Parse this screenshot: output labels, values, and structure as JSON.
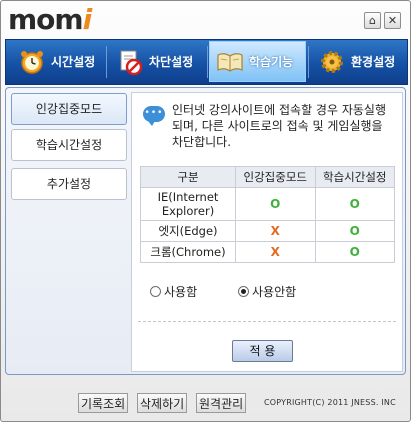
{
  "app": {
    "logo_text": "mom",
    "logo_accent": "i",
    "home_button": "⌂",
    "close_button": "✕"
  },
  "tabs": [
    {
      "label": "시간설정",
      "icon": "alarm-clock-icon"
    },
    {
      "label": "차단설정",
      "icon": "blocked-document-icon"
    },
    {
      "label": "학습기능",
      "icon": "open-book-icon",
      "active": true
    },
    {
      "label": "환경설정",
      "icon": "gear-icon"
    }
  ],
  "sidebar": {
    "items": [
      {
        "label": "인강집중모드",
        "active": true
      },
      {
        "label": "학습시간설정"
      },
      {
        "label": "추가설정"
      }
    ]
  },
  "info": {
    "text": "인터넷 강의사이트에 접속할 경우 자동실행되며, 다른 사이트로의 접속 및 게임실행을 차단합니다."
  },
  "table": {
    "headers": [
      "구분",
      "인강집중모드",
      "학습시간설정"
    ],
    "rows": [
      {
        "name": "IE(Internet Explorer)",
        "mode": "O",
        "study": "O"
      },
      {
        "name": "엣지(Edge)",
        "mode": "X",
        "study": "O"
      },
      {
        "name": "크롬(Chrome)",
        "mode": "X",
        "study": "O"
      }
    ]
  },
  "options": {
    "use_label": "사용함",
    "nouse_label": "사용안함",
    "selected": "사용안함"
  },
  "apply_label": "적 용",
  "footer": {
    "history_label": "기록조회",
    "delete_label": "삭제하기",
    "remote_label": "원격관리",
    "copyright": "COPYRIGHT(C) 2011 JNESS. INC"
  },
  "colors": {
    "tab_bar": "#1551a5",
    "ok": "#3fb13a",
    "no": "#e36a22"
  }
}
